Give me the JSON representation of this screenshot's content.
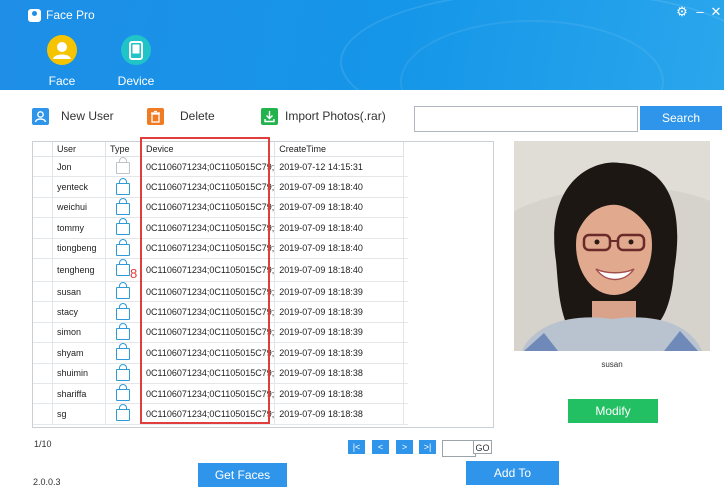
{
  "window": {
    "title": "Face Pro",
    "settings_icon": "gear-icon",
    "minimize_label": "–",
    "close_label": "✕"
  },
  "nav_tabs": [
    {
      "label": "Face",
      "icon": "person-icon"
    },
    {
      "label": "Device",
      "icon": "tablet-icon"
    }
  ],
  "toolbar": {
    "new_user_label": "New User",
    "delete_label": "Delete",
    "import_label": "Import Photos(.rar)",
    "search_value": "",
    "search_label": "Search"
  },
  "colors": {
    "header": "#1e8ee6",
    "accent": "#2f95ea",
    "modify": "#22c062",
    "highlight": "#e03d3d"
  },
  "table": {
    "headers": [
      "User",
      "Type",
      "Device",
      "CreateTime"
    ],
    "rows": [
      {
        "user": "Jon",
        "device": "0C1106071234;0C1105015C79;",
        "time": "2019-07-12 14:15:31"
      },
      {
        "user": "yenteck",
        "device": "0C1106071234;0C1105015C79;",
        "time": "2019-07-09 18:18:40"
      },
      {
        "user": "weichui",
        "device": "0C1106071234;0C1105015C79;",
        "time": "2019-07-09 18:18:40"
      },
      {
        "user": "tommy",
        "device": "0C1106071234;0C1105015C79;",
        "time": "2019-07-09 18:18:40"
      },
      {
        "user": "tiongbeng",
        "device": "0C1106071234;0C1105015C79;",
        "time": "2019-07-09 18:18:40"
      },
      {
        "user": "tengheng",
        "device": "0C1106071234;0C1105015C79;",
        "time": "2019-07-09 18:18:40",
        "mark": "8"
      },
      {
        "user": "susan",
        "device": "0C1106071234;0C1105015C79;",
        "time": "2019-07-09 18:18:39"
      },
      {
        "user": "stacy",
        "device": "0C1106071234;0C1105015C79;",
        "time": "2019-07-09 18:18:39"
      },
      {
        "user": "simon",
        "device": "0C1106071234;0C1105015C79;",
        "time": "2019-07-09 18:18:39"
      },
      {
        "user": "shyam",
        "device": "0C1106071234;0C1105015C79;",
        "time": "2019-07-09 18:18:39"
      },
      {
        "user": "shuimin",
        "device": "0C1106071234;0C1105015C79;",
        "time": "2019-07-09 18:18:38"
      },
      {
        "user": "shariffa",
        "device": "0C1106071234;0C1105015C79;",
        "time": "2019-07-09 18:18:38"
      },
      {
        "user": "sg",
        "device": "0C1106071234;0C1105015C79;",
        "time": "2019-07-09 18:18:38"
      }
    ]
  },
  "preview": {
    "caption": "susan",
    "modify_label": "Modify"
  },
  "pager": {
    "page_info": "1/10",
    "first": "|<",
    "prev": "<",
    "next": ">",
    "last": ">|",
    "go": "GO"
  },
  "footer": {
    "get_faces_label": "Get Faces",
    "add_to_label": "Add To",
    "version": "2.0.0.3"
  }
}
